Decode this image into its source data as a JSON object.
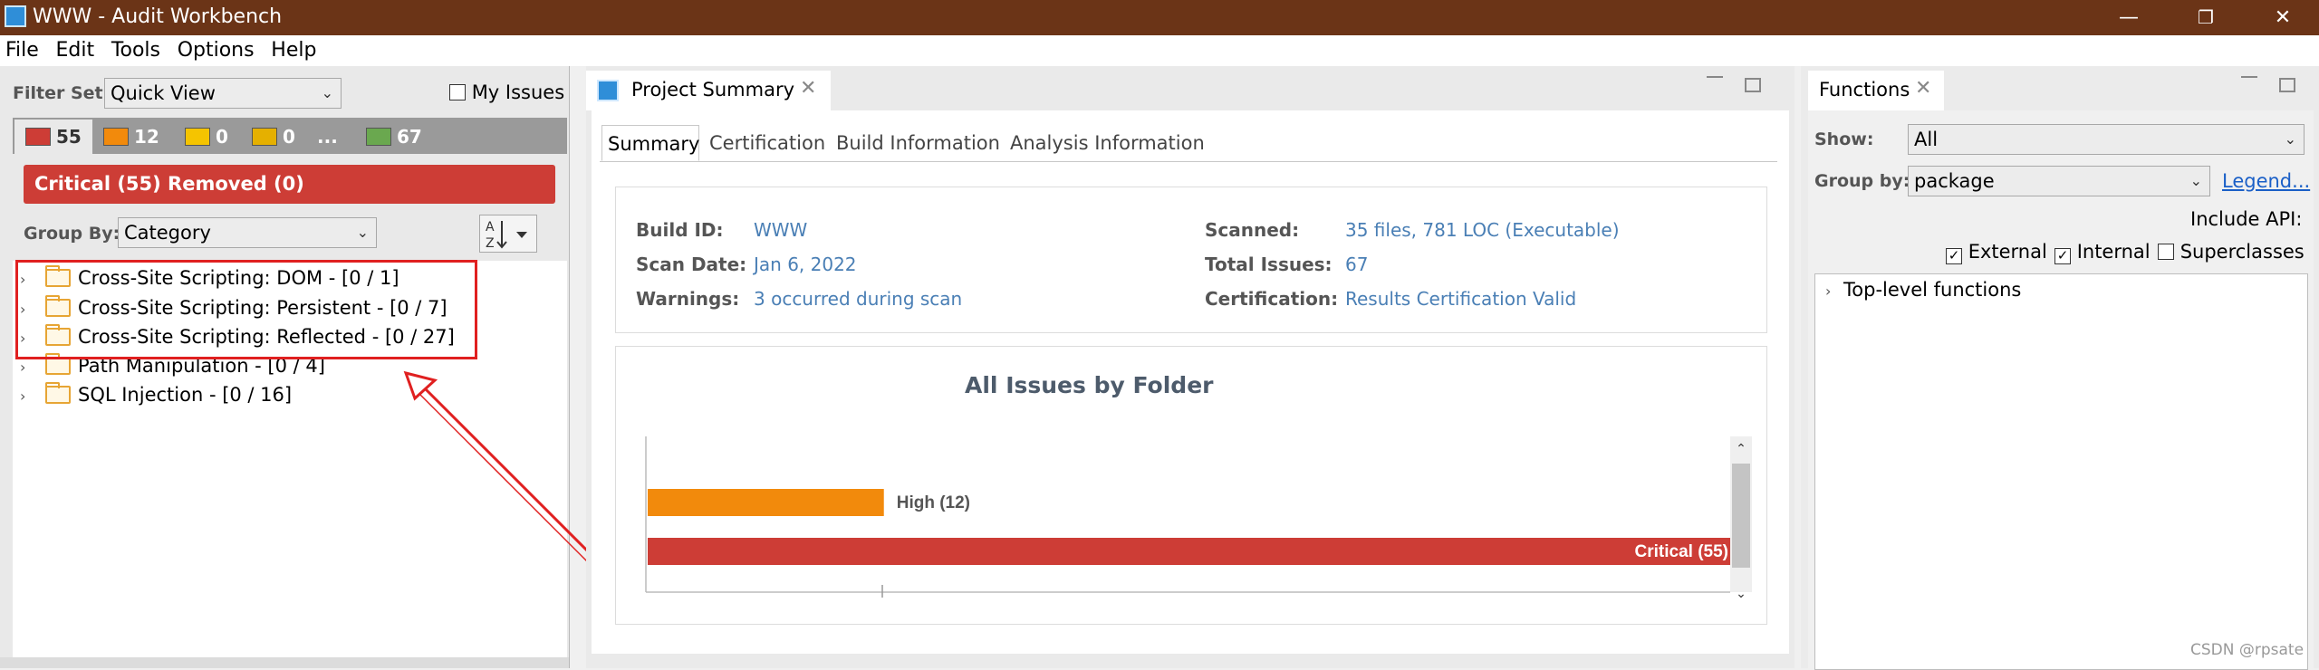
{
  "window": {
    "title": "WWW - Audit Workbench",
    "minimize": "—",
    "restore": "❐",
    "close": "✕"
  },
  "menu": [
    "File",
    "Edit",
    "Tools",
    "Options",
    "Help"
  ],
  "left": {
    "filter_label": "Filter Set:",
    "filter_value": "Quick View",
    "my_issues_label": "My Issues",
    "tabs": [
      {
        "count": "55",
        "color": "#cd3d36"
      },
      {
        "count": "12",
        "color": "#f28a0c"
      },
      {
        "count": "0",
        "color": "#f5c400"
      },
      {
        "count": "0",
        "color": "#e5b000"
      },
      {
        "count": "...",
        "color": ""
      },
      {
        "count": "67",
        "color": "#6aa84f"
      }
    ],
    "critical_bar": "Critical (55) Removed (0)",
    "group_by_label": "Group By:",
    "group_by_value": "Category",
    "sort_icon": "sort-az-icon",
    "tree": [
      "Cross-Site Scripting: DOM - [0 / 1]",
      "Cross-Site Scripting: Persistent - [0 / 7]",
      "Cross-Site Scripting: Reflected - [0 / 27]",
      "Path Manipulation - [0 / 4]",
      "SQL Injection - [0 / 16]"
    ]
  },
  "middle": {
    "tab_title": "Project Summary",
    "subtabs": [
      "Summary",
      "Certification",
      "Build Information",
      "Analysis Information"
    ],
    "info": {
      "build_id_label": "Build ID:",
      "build_id": "WWW",
      "scan_date_label": "Scan Date:",
      "scan_date": "Jan 6, 2022",
      "warnings_label": "Warnings:",
      "warnings": "3 occurred during scan",
      "scanned_label": "Scanned:",
      "scanned": "35 files, 781 LOC (Executable)",
      "total_label": "Total Issues:",
      "total": "67",
      "cert_label": "Certification:",
      "cert": "Results Certification Valid"
    }
  },
  "chart_data": {
    "type": "bar",
    "orientation": "horizontal",
    "title": "All Issues by Folder",
    "categories": [
      "High",
      "Critical"
    ],
    "labels": [
      "High (12)",
      "Critical (55)"
    ],
    "values": [
      12,
      55
    ],
    "colors": [
      "#f28a0c",
      "#cd3d36"
    ],
    "xlim": [
      0,
      55
    ]
  },
  "right": {
    "tab_title": "Functions",
    "show_label": "Show:",
    "show_value": "All",
    "group_label": "Group by:",
    "group_value": "package",
    "legend_link": "Legend...",
    "include_api": "Include API:",
    "external": "External",
    "internal": "Internal",
    "superclasses": "Superclasses",
    "tree_root": "Top-level functions"
  },
  "watermark": "CSDN @rpsate"
}
